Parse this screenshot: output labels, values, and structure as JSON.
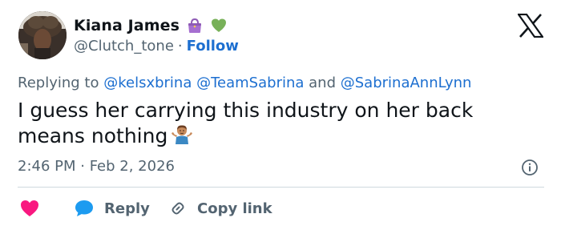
{
  "author": {
    "display_name": "Kiana James",
    "handle": "@Clutch_tone",
    "separator": "·",
    "follow_label": "Follow",
    "badges": [
      "purse-emoji",
      "green-heart-emoji"
    ]
  },
  "reply_context": {
    "prefix": "Replying to",
    "mentions": [
      "@kelsxbrina",
      "@TeamSabrina",
      "@SabrinaAnnLynn"
    ],
    "conjunction": "and"
  },
  "tweet": {
    "text": "I guess her carrying this industry on her back means nothing",
    "trailing_emoji": "man-shrugging-emoji",
    "timestamp": "2:46 PM · Feb 2, 2026"
  },
  "actions": {
    "like_icon": "heart-icon",
    "reply_label": "Reply",
    "copy_label": "Copy link"
  },
  "colors": {
    "text": "#0f1419",
    "muted": "#536471",
    "link": "#1d6fd0",
    "like": "#f91880",
    "reply": "#1d9bf0",
    "divider": "#cfd9de"
  }
}
